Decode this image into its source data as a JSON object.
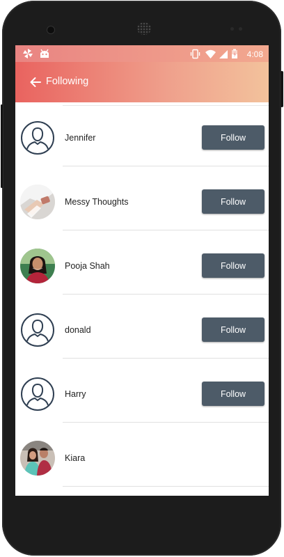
{
  "statusbar": {
    "time": "4:08",
    "icons": [
      "pinwheel-icon",
      "android-icon",
      "vibrate-icon",
      "wifi-icon",
      "signal-icon",
      "battery-charging-icon"
    ]
  },
  "header": {
    "title": "Following",
    "back_icon": "arrow-left-icon"
  },
  "colors": {
    "header_start": "#e9635f",
    "header_end": "#f3c29c",
    "button": "#4d5b68",
    "avatar_outline": "#2f3f52"
  },
  "users": [
    {
      "name": "Jennifer",
      "avatar": "default-avatar",
      "button": "Follow"
    },
    {
      "name": "Messy Thoughts",
      "avatar": "photo-hand-watch",
      "button": "Follow"
    },
    {
      "name": "Pooja Shah",
      "avatar": "photo-woman",
      "button": "Follow"
    },
    {
      "name": "donald",
      "avatar": "default-avatar",
      "button": "Follow"
    },
    {
      "name": "Harry",
      "avatar": "default-avatar",
      "button": "Follow"
    },
    {
      "name": "Kiara",
      "avatar": "photo-couple",
      "button": null
    }
  ]
}
